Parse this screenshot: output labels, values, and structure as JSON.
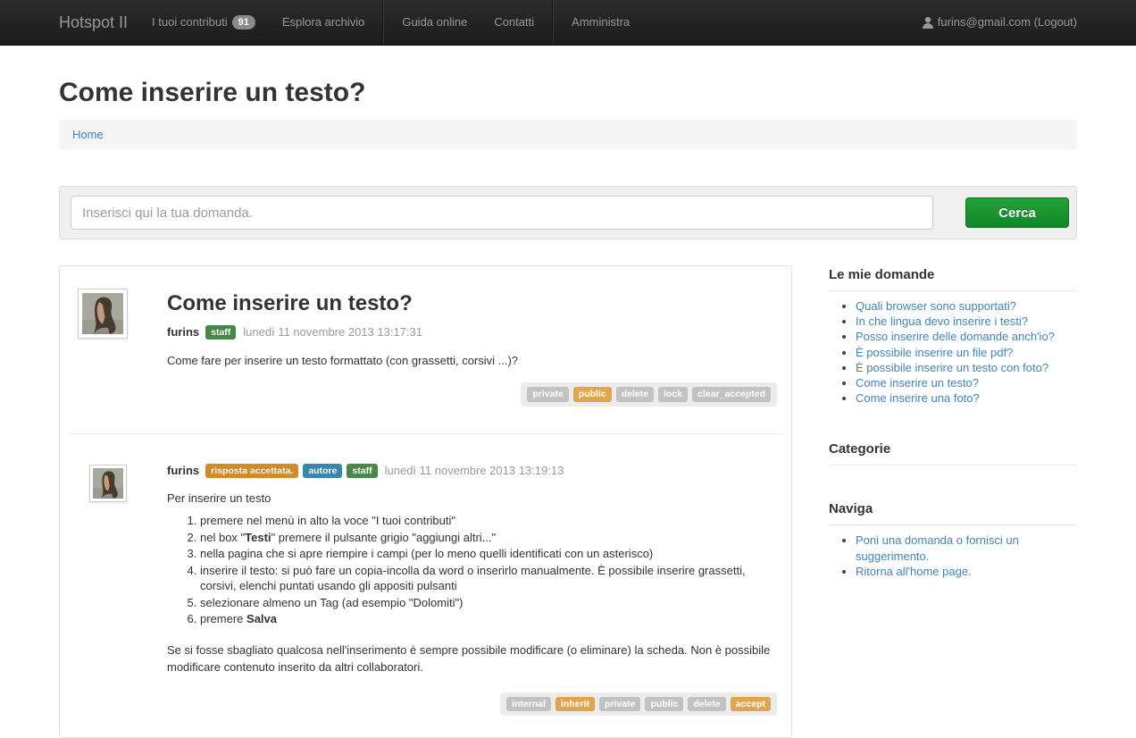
{
  "colors": {
    "link": "#4184bc",
    "btn_top": "#23a338",
    "btn_bottom": "#128627",
    "badge": {
      "success": "#468847",
      "info": "#3a87ad",
      "warning": "#d08c28"
    },
    "tag": {
      "gray": "#c2c2c2",
      "orange": "#e0a64e"
    }
  },
  "navbar": {
    "brand": "Hotspot II",
    "items": [
      {
        "label": "I tuoi contributi",
        "badge": "91"
      },
      {
        "label": "Esplora archivio"
      },
      {
        "label": "Guida online",
        "divider_before": true
      },
      {
        "label": "Contatti"
      },
      {
        "label": "Amministra",
        "divider_before": true
      }
    ],
    "user": "furins@gmail.com (Logout)"
  },
  "page": {
    "title": "Come inserire un testo?"
  },
  "breadcrumb": {
    "home": "Home"
  },
  "search": {
    "placeholder": "Inserisci qui la tua domanda.",
    "button": "Cerca"
  },
  "question": {
    "title": "Come inserire un testo?",
    "author": "furins",
    "badges": [
      {
        "label": "staff",
        "type": "success"
      }
    ],
    "date": "lunedì 11 novembre 2013 13:17:31",
    "body": "Come fare per inserire un testo formattato (con grassetti, corsivi ...)?",
    "tags": [
      {
        "label": "private",
        "type": "gray"
      },
      {
        "label": "public",
        "type": "orange"
      },
      {
        "label": "delete",
        "type": "gray"
      },
      {
        "label": "lock",
        "type": "gray"
      },
      {
        "label": "clear_accepted",
        "type": "gray"
      }
    ]
  },
  "answer": {
    "author": "furins",
    "badges": [
      {
        "label": "risposta accettata.",
        "type": "warning"
      },
      {
        "label": "autore",
        "type": "info"
      },
      {
        "label": "staff",
        "type": "success"
      }
    ],
    "date": "lunedì 11 novembre 2013 13:19:13",
    "intro": "Per inserire un testo",
    "steps": [
      [
        {
          "t": "premere nel menù in alto la voce \"I tuoi contributi\""
        }
      ],
      [
        {
          "t": "nel box \""
        },
        {
          "t": "Testi",
          "b": true
        },
        {
          "t": "\" premere il pulsante grigio \"aggiungi altri...\""
        }
      ],
      [
        {
          "t": "nella pagina che si apre riempire i campi (per lo meno quelli identificati con un asterisco)"
        }
      ],
      [
        {
          "t": "inserire il testo: si può fare un copia-incolla da word o inserirlo manualmente. È possibile inserire grassetti, corsivi, elenchi puntati usando gli appositi pulsanti"
        }
      ],
      [
        {
          "t": "selezionare almeno un Tag (ad esempio \"Dolomiti\")"
        }
      ],
      [
        {
          "t": "premere "
        },
        {
          "t": "Salva",
          "b": true
        }
      ]
    ],
    "outro": "Se si fosse sbagliato qualcosa nell'inserimento è sempre possibile modificare (o eliminare) la scheda. Non è possibile modificare contenuto inserito da altri collaboratori.",
    "tags": [
      {
        "label": "internal",
        "type": "gray"
      },
      {
        "label": "inherit",
        "type": "orange"
      },
      {
        "label": "private",
        "type": "gray"
      },
      {
        "label": "public",
        "type": "gray"
      },
      {
        "label": "delete",
        "type": "gray"
      },
      {
        "label": "accept",
        "type": "orange"
      }
    ]
  },
  "sidebar": {
    "my_questions": {
      "title": "Le mie domande",
      "items": [
        "Quali browser sono supportati?",
        "In che lingua devo inserire i testi?",
        "Posso inserire delle domande anch'io?",
        "È possibile inserire un file pdf?",
        "È possibile inserire un testo con foto?",
        "Come inserire un testo?",
        "Come inserire una foto?"
      ]
    },
    "categories": {
      "title": "Categorie"
    },
    "navigate": {
      "title": "Naviga",
      "items": [
        "Poni una domanda o fornisci un suggerimento.",
        "Ritorna all'home page."
      ]
    }
  }
}
